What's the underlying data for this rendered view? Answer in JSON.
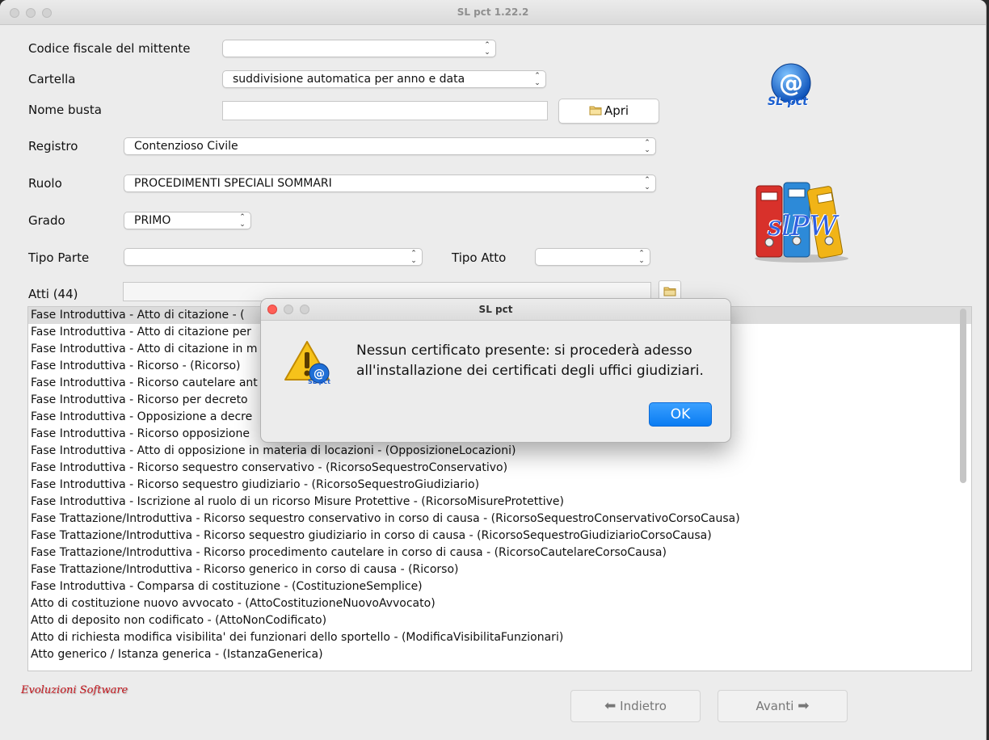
{
  "window": {
    "title": "SL pct 1.22.2"
  },
  "form": {
    "codice_fiscale_label": "Codice fiscale del mittente",
    "codice_fiscale_value": "",
    "cartella_label": "Cartella",
    "cartella_value": "suddivisione automatica per anno e data",
    "nome_busta_label": "Nome busta",
    "nome_busta_value": "",
    "apri_label": "Apri",
    "registro_label": "Registro",
    "registro_value": "Contenzioso Civile",
    "ruolo_label": "Ruolo",
    "ruolo_value": "PROCEDIMENTI SPECIALI SOMMARI",
    "grado_label": "Grado",
    "grado_value": "PRIMO",
    "tipo_parte_label": "Tipo Parte",
    "tipo_parte_value": "",
    "tipo_atto_label": "Tipo Atto",
    "tipo_atto_value": "",
    "atti_label": "Atti (44)",
    "atti_filter_value": ""
  },
  "logos": {
    "slpct_text": "SL-pct",
    "slpw_text": "slPW"
  },
  "atti_list": [
    "Fase Introduttiva - Atto di citazione - (",
    "Fase Introduttiva - Atto di citazione per",
    "Fase Introduttiva - Atto di citazione in m",
    "Fase Introduttiva - Ricorso - (Ricorso)",
    "Fase Introduttiva - Ricorso cautelare ant",
    "Fase Introduttiva - Ricorso per decreto",
    "Fase Introduttiva - Opposizione a decre",
    "Fase Introduttiva - Ricorso opposizione",
    "Fase Introduttiva - Atto di opposizione in materia di locazioni - (OpposizioneLocazioni)",
    "Fase Introduttiva - Ricorso sequestro conservativo - (RicorsoSequestroConservativo)",
    "Fase Introduttiva - Ricorso sequestro giudiziario - (RicorsoSequestroGiudiziario)",
    "Fase Introduttiva - Iscrizione al ruolo di un ricorso Misure Protettive - (RicorsoMisureProtettive)",
    "Fase Trattazione/Introduttiva - Ricorso sequestro conservativo in corso di causa - (RicorsoSequestroConservativoCorsoCausa)",
    "Fase Trattazione/Introduttiva - Ricorso sequestro giudiziario in corso di causa - (RicorsoSequestroGiudiziarioCorsoCausa)",
    "Fase Trattazione/Introduttiva - Ricorso procedimento cautelare in corso di causa - (RicorsoCautelareCorsoCausa)",
    "Fase Trattazione/Introduttiva - Ricorso generico in corso di causa - (Ricorso)",
    "Fase Introduttiva - Comparsa di costituzione - (CostituzioneSemplice)",
    "Atto di costituzione nuovo avvocato - (AttoCostituzioneNuovoAvvocato)",
    "Atto di deposito non codificato - (AttoNonCodificato)",
    "Atto di richiesta modifica visibilita' dei funzionari dello sportello - (ModificaVisibilitaFunzionari)",
    "Atto generico / Istanza generica - (IstanzaGenerica)"
  ],
  "footer": {
    "brand": "Evoluzioni Software",
    "back_label": "Indietro",
    "next_label": "Avanti"
  },
  "dialog": {
    "title": "SL pct",
    "message_line1": "Nessun certificato presente: si procederà adesso",
    "message_line2": "all'installazione dei certificati degli uffici giudiziari.",
    "ok_label": "OK",
    "icon_text": "SL pct"
  },
  "colors": {
    "accent": "#0a7cf2",
    "brand": "#c4151c",
    "warning": "#f2b705"
  }
}
